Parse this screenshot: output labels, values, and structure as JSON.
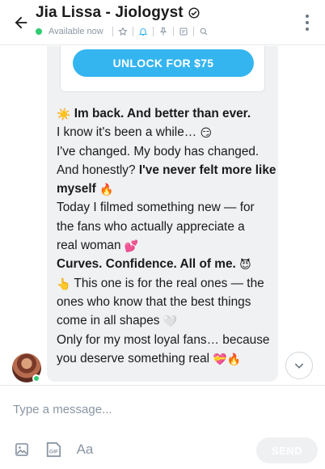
{
  "header": {
    "title": "Jia Lissa - Jiologyst",
    "status": "Available now"
  },
  "locked_post": {
    "unlock_label": "UNLOCK FOR $75"
  },
  "message": {
    "lines": [
      {
        "emoji": "☀️",
        "text": " Im back. And better than ever.",
        "bold": true
      },
      {
        "text": "I know it's been a while… ",
        "emoji_after": "😏"
      },
      {
        "text": "I've changed. My body has changed."
      },
      {
        "text": "And honestly? ",
        "bold_text": "I've never felt more like"
      },
      {
        "bold_text": "myself",
        "emoji_after": "🔥"
      },
      {
        "text": "Today I filmed something new — for"
      },
      {
        "text": "the fans who actually appreciate a"
      },
      {
        "text": "real woman ",
        "emoji_after": "💕"
      },
      {
        "bold_text": "Curves. Confidence. All of me.",
        "emoji_after": "😈"
      },
      {
        "emoji": "👆",
        "text": " This one is for the real ones — the"
      },
      {
        "text": "ones who know that the best things"
      },
      {
        "text": "come in all shapes ",
        "emoji_after": "🤍"
      },
      {
        "text": "Only for my most loyal fans… because"
      },
      {
        "text": "you deserve something real ",
        "emoji_after": "💝🔥"
      }
    ]
  },
  "composer": {
    "placeholder": "Type a message...",
    "text_format_label": "Aa",
    "gif_label": "GIF",
    "send_label": "SEND"
  },
  "colors": {
    "accent": "#34b5f0",
    "online": "#2fcc71",
    "muted": "#8a96a3"
  }
}
